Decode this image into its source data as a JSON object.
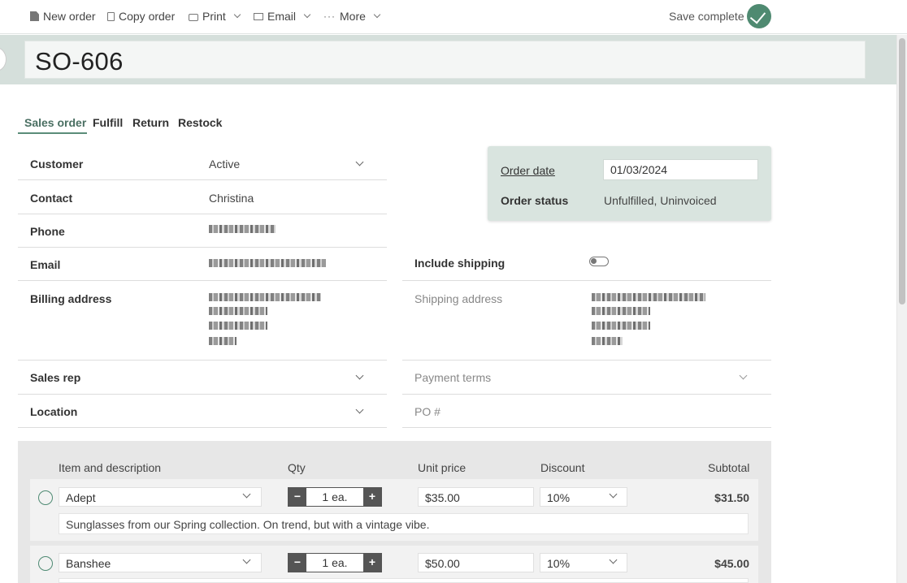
{
  "toolbar": {
    "new_order": "New order",
    "copy_order": "Copy order",
    "print": "Print",
    "email": "Email",
    "more": "More",
    "save_status": "Save complete"
  },
  "order": {
    "title": "SO-606"
  },
  "tabs": [
    "Sales order",
    "Fulfill",
    "Return",
    "Restock"
  ],
  "left_fields": {
    "customer_label": "Customer",
    "customer_value": "Active",
    "contact_label": "Contact",
    "contact_value": "Christina",
    "phone_label": "Phone",
    "email_label": "Email",
    "billing_label": "Billing address",
    "sales_rep_label": "Sales rep",
    "location_label": "Location"
  },
  "order_panel": {
    "order_date_label": "Order date",
    "order_date_value": "01/03/2024",
    "order_status_label": "Order status",
    "order_status_value": "Unfulfilled, Uninvoiced"
  },
  "right_fields": {
    "include_shipping_label": "Include shipping",
    "include_shipping_on": false,
    "shipping_address_label": "Shipping address",
    "payment_terms_label": "Payment terms",
    "po_label": "PO #"
  },
  "items_header": {
    "item": "Item and description",
    "qty": "Qty",
    "unit_price": "Unit price",
    "discount": "Discount",
    "subtotal": "Subtotal"
  },
  "line_items": [
    {
      "name": "Adept",
      "qty": "1 ea.",
      "unit_price": "$35.00",
      "discount": "10%",
      "subtotal": "$31.50",
      "description": "Sunglasses from our Spring collection. On trend, but with a vintage vibe."
    },
    {
      "name": "Banshee",
      "qty": "1 ea.",
      "unit_price": "$50.00",
      "discount": "10%",
      "subtotal": "$45.00",
      "description": ""
    }
  ],
  "qty_controls": {
    "minus": "−",
    "plus": "+"
  },
  "colors": {
    "accent": "#4f8a71",
    "band": "#d5dfdb",
    "panel": "#d9e4df"
  }
}
